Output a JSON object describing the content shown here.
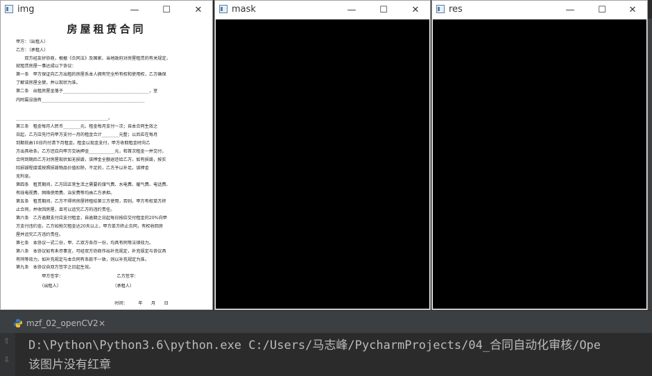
{
  "windows": {
    "img": {
      "title": "img"
    },
    "mask": {
      "title": "mask"
    },
    "res": {
      "title": "res"
    }
  },
  "controls": {
    "minimize": "—",
    "maximize": "☐",
    "close": "✕"
  },
  "document": {
    "title": "房屋租赁合同",
    "lines": [
      "甲方：（出租人）",
      "乙方：（承租人）",
      "　　双方经友好协商，根据《合同法》及国家、当地政府对房屋租赁的有关规定，",
      "就租赁房屋一事达成以下协议：",
      "第一条　甲方保证向乙方出租的房屋系本人拥有完全所有权和使用权，乙方确保",
      "了解该房屋全貌，并以现状为准。",
      "第二条　出租房屋坐落于________________________________________，室",
      "内附属设施有________________________________________________",
      "",
      "___________________________________________。",
      "第三条　租金每月人民币________元，租金每月支付一次；自本合同生效之",
      "日起，乙方应先行向甲方支付一月的租金合计________元整；以后应在每月",
      "到期前由10日内付清下月租金。租金以现金支付，甲方收取租金时向乙",
      "方出具收条。乙方还应向甲方交纳押金____________元，和首次租金一并交付，",
      "合同到期后乙方对房屋现状如无损毁，该押金全额退还给乙方，如有损毁，按实",
      "际损毁程度或按照损毁物品价值扣除，不足的，乙方予以补足。该押金",
      "无利息。",
      "第四条　租赁期间，乙方因正常生活之需要的煤气费、水电费、暖气费、电话费、",
      "有线电视费、网络使用费、治安费等均由乙方承担。",
      "第五条　租赁期间，乙方不得将房屋转租给第三方使用，否则，甲方有权单方终",
      "止合同，并收回房屋，且可以追究乙方的违约责任。",
      "第六条　乙方逾期支付应支付租金，自逾期之日起每日按应交付租金的20%向甲",
      "方支付违约金。乙方如拖欠租金达20天以上，甲方单方终止合同，有权收回房",
      "屋并追究乙方违约责任。",
      "第七条　本协议一式二份，甲、乙双方各存一份，均具有同等法律效力。",
      "第八条　本协议如有未尽事宜，可经双方协商作出补充规定，补充规定与协议具",
      "有同等效力。如补充规定与本合同有条款不一致，则以补充规定为准。",
      "第九条　本协议自双方签字之日起生效。",
      "　　　　　　甲方签字：　　　　　　　　　　　　　乙方签字：",
      "　　　　　　（出租人）　　　　　　　　　　　　　（承租人）",
      "",
      "　　　　　　　　　　　　　　　　　　　　　　　时间：　　　年　　月　　日"
    ]
  },
  "run_panel": {
    "tab_label": "mzf_02_openCV2",
    "tab_close": "×"
  },
  "console": {
    "line1": "D:\\Python\\Python3.6\\python.exe C:/Users/马志峰/PycharmProjects/04_合同自动化审核/Ope",
    "line2": "该图片没有红章"
  }
}
